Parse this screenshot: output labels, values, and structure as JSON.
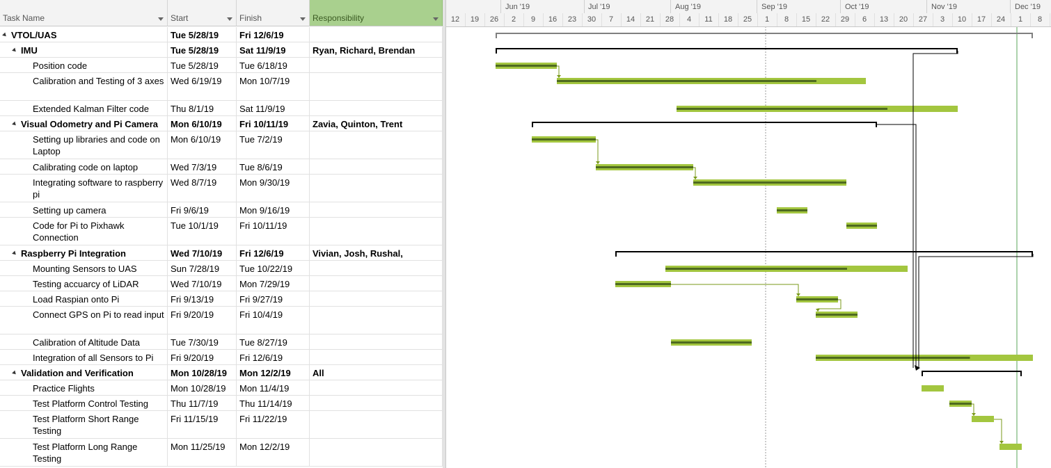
{
  "columns": {
    "name": "Task Name",
    "start": "Start",
    "finish": "Finish",
    "responsibility": "Responsibility"
  },
  "timeline": {
    "months": [
      "Jun '19",
      "Jul '19",
      "Aug '19",
      "Sep '19",
      "Oct '19",
      "Nov '19",
      "Dec '19"
    ],
    "weeks": [
      "12",
      "19",
      "26",
      "2",
      "9",
      "16",
      "23",
      "30",
      "7",
      "14",
      "21",
      "28",
      "4",
      "11",
      "18",
      "25",
      "1",
      "8",
      "15",
      "22",
      "29",
      "6",
      "13",
      "20",
      "27",
      "3",
      "10",
      "17",
      "24",
      "1",
      "8"
    ]
  },
  "colors": {
    "bar": "#a3c63f",
    "progress": "#4e6a1f",
    "link": "#7a9a1a",
    "summary": "#000000",
    "project_summary": "#7f7f7f",
    "status_line": "#5aa55a"
  },
  "tasks": [
    {
      "level": 0,
      "summary": true,
      "name": "VTOL/UAS",
      "start": "Tue 5/28/19",
      "finish": "Fri 12/6/19",
      "resp": ""
    },
    {
      "level": 1,
      "summary": true,
      "name": "IMU",
      "start": "Tue 5/28/19",
      "finish": "Sat 11/9/19",
      "resp": "Ryan, Richard, Brendan"
    },
    {
      "level": 2,
      "summary": false,
      "name": "Position code",
      "start": "Tue 5/28/19",
      "finish": "Tue 6/18/19",
      "resp": "",
      "progress": 1.0
    },
    {
      "level": 2,
      "summary": false,
      "name": "Calibration and Testing of 3 axes",
      "start": "Wed 6/19/19",
      "finish": "Mon 10/7/19",
      "resp": "",
      "progress": 0.84
    },
    {
      "level": 2,
      "summary": false,
      "name": "Extended Kalman Filter code",
      "start": "Thu 8/1/19",
      "finish": "Sat 11/9/19",
      "resp": "",
      "progress": 0.75
    },
    {
      "level": 1,
      "summary": true,
      "name": "Visual Odometry and Pi Camera",
      "start": "Mon 6/10/19",
      "finish": "Fri 10/11/19",
      "resp": "Zavia, Quinton, Trent"
    },
    {
      "level": 2,
      "summary": false,
      "name": "Setting up libraries and code on Laptop",
      "start": "Mon 6/10/19",
      "finish": "Tue 7/2/19",
      "resp": "",
      "progress": 1.0
    },
    {
      "level": 2,
      "summary": false,
      "name": "Calibrating code on laptop",
      "start": "Wed 7/3/19",
      "finish": "Tue 8/6/19",
      "resp": "",
      "progress": 1.0
    },
    {
      "level": 2,
      "summary": false,
      "name": "Integrating software to raspberry pi",
      "start": "Wed 8/7/19",
      "finish": "Mon 9/30/19",
      "resp": "",
      "progress": 1.0
    },
    {
      "level": 2,
      "summary": false,
      "name": "Setting up camera",
      "start": "Fri 9/6/19",
      "finish": "Mon 9/16/19",
      "resp": "",
      "progress": 1.0
    },
    {
      "level": 2,
      "summary": false,
      "name": "Code for Pi to Pixhawk Connection",
      "start": "Tue 10/1/19",
      "finish": "Fri 10/11/19",
      "resp": "",
      "progress": 1.0
    },
    {
      "level": 1,
      "summary": true,
      "name": "Raspberry Pi Integration",
      "start": "Wed 7/10/19",
      "finish": "Fri 12/6/19",
      "resp": "Vivian, Josh, Rushal, Nicholas"
    },
    {
      "level": 2,
      "summary": false,
      "name": "Mounting Sensors to UAS",
      "start": "Sun 7/28/19",
      "finish": "Tue 10/22/19",
      "resp": "",
      "progress": 0.75
    },
    {
      "level": 2,
      "summary": false,
      "name": "Testing accuarcy of LiDAR",
      "start": "Wed 7/10/19",
      "finish": "Mon 7/29/19",
      "resp": "",
      "progress": 1.0
    },
    {
      "level": 2,
      "summary": false,
      "name": "Load Raspian onto Pi",
      "start": "Fri 9/13/19",
      "finish": "Fri 9/27/19",
      "resp": "",
      "progress": 1.0
    },
    {
      "level": 2,
      "summary": false,
      "name": "Connect GPS on Pi to read input",
      "start": "Fri 9/20/19",
      "finish": "Fri 10/4/19",
      "resp": "",
      "progress": 1.0
    },
    {
      "level": 2,
      "summary": false,
      "name": "Calibration of Altitude Data",
      "start": "Tue 7/30/19",
      "finish": "Tue 8/27/19",
      "resp": "",
      "progress": 1.0
    },
    {
      "level": 2,
      "summary": false,
      "name": "Integration of all Sensors to Pi",
      "start": "Fri 9/20/19",
      "finish": "Fri 12/6/19",
      "resp": "",
      "progress": 0.71
    },
    {
      "level": 1,
      "summary": true,
      "name": "Validation and Verification",
      "start": "Mon 10/28/19",
      "finish": "Mon 12/2/19",
      "resp": "All"
    },
    {
      "level": 2,
      "summary": false,
      "name": "Practice Flights",
      "start": "Mon 10/28/19",
      "finish": "Mon 11/4/19",
      "resp": "",
      "progress": 0.0
    },
    {
      "level": 2,
      "summary": false,
      "name": "Test Platform Control Testing",
      "start": "Thu 11/7/19",
      "finish": "Thu 11/14/19",
      "resp": "",
      "progress": 1.0
    },
    {
      "level": 2,
      "summary": false,
      "name": "Test Platform Short Range Testing",
      "start": "Fri 11/15/19",
      "finish": "Fri 11/22/19",
      "resp": "",
      "progress": 0.0
    },
    {
      "level": 2,
      "summary": false,
      "name": "Test Platform Long Range Testing",
      "start": "Mon 11/25/19",
      "finish": "Mon 12/2/19",
      "resp": "",
      "progress": 0.0
    }
  ],
  "links": [
    {
      "from": 2,
      "to": 3
    },
    {
      "from": 6,
      "to": 7
    },
    {
      "from": 7,
      "to": 8
    },
    {
      "from": 13,
      "to": 14
    },
    {
      "from": 14,
      "to": 15
    },
    {
      "from": 20,
      "to": 21
    },
    {
      "from": 21,
      "to": 22
    }
  ]
}
